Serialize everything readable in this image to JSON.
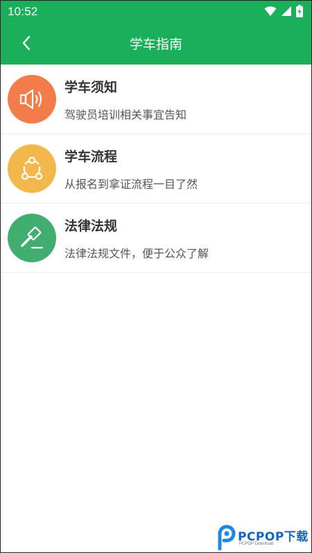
{
  "status_bar": {
    "time": "10:52",
    "icons": [
      "wifi-icon",
      "cell-signal-icon",
      "battery-charging-icon"
    ]
  },
  "app_bar": {
    "title": "学车指南",
    "back_icon": "chevron-left-icon"
  },
  "colors": {
    "primary": "#1ab05b",
    "notice_icon_bg": "#f47c4b",
    "process_icon_bg": "#f3b84c",
    "law_icon_bg": "#41ae6f"
  },
  "items": [
    {
      "title": "学车须知",
      "desc": "驾驶员培训相关事宜告知",
      "icon": "speaker-icon"
    },
    {
      "title": "学车流程",
      "desc": "从报名到拿证流程一目了然",
      "icon": "share-nodes-icon"
    },
    {
      "title": "法律法规",
      "desc": "法律法规文件，便于公众了解",
      "icon": "gavel-icon"
    }
  ],
  "watermark": {
    "brand": "PCPOP下载",
    "sub": "PCPOP Download"
  }
}
